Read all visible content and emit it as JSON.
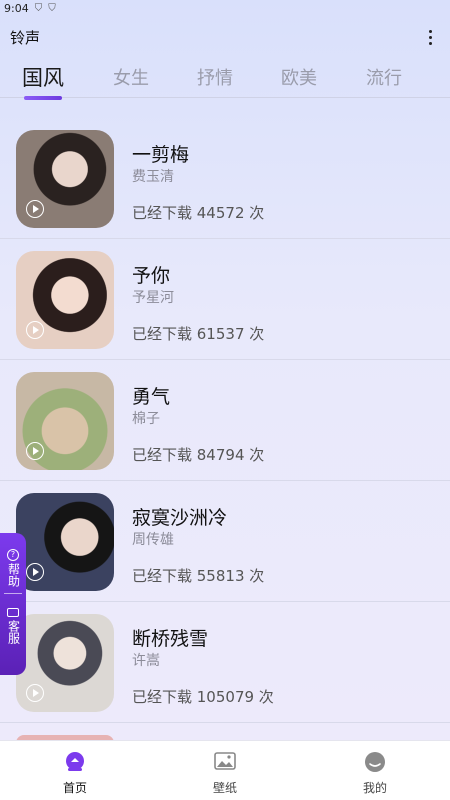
{
  "status_bar": {
    "time": "9:04"
  },
  "app_bar": {
    "title": "铃声",
    "more_icon": "more-vert-icon"
  },
  "tabs": [
    {
      "label": "国风",
      "active": true
    },
    {
      "label": "女生",
      "active": false
    },
    {
      "label": "抒情",
      "active": false
    },
    {
      "label": "欧美",
      "active": false
    },
    {
      "label": "流行",
      "active": false
    }
  ],
  "songs": [
    {
      "title": "一剪梅",
      "singer": "费玉清",
      "downloads": "已经下载 44572 次",
      "thumb_color": "#7a6a63"
    },
    {
      "title": "予你",
      "singer": "予星河",
      "downloads": "已经下载 61537 次",
      "thumb_color": "#d8b8a8"
    },
    {
      "title": "勇气",
      "singer": "棉子",
      "downloads": "已经下载 84794 次",
      "thumb_color": "#a8b88a"
    },
    {
      "title": "寂寞沙洲冷",
      "singer": "周传雄",
      "downloads": "已经下载 55813 次",
      "thumb_color": "#3a3f52"
    },
    {
      "title": "断桥残雪",
      "singer": "许嵩",
      "downloads": "已经下载 105079 次",
      "thumb_color": "#c8c4c0"
    }
  ],
  "help_tab": {
    "help_label": "帮助",
    "service_label": "客服",
    "accent": "#6d28d9"
  },
  "bottom_nav": [
    {
      "label": "首页",
      "icon": "home-icon",
      "active": true
    },
    {
      "label": "壁纸",
      "icon": "wallpaper-icon",
      "active": false
    },
    {
      "label": "我的",
      "icon": "profile-icon",
      "active": false
    }
  ]
}
